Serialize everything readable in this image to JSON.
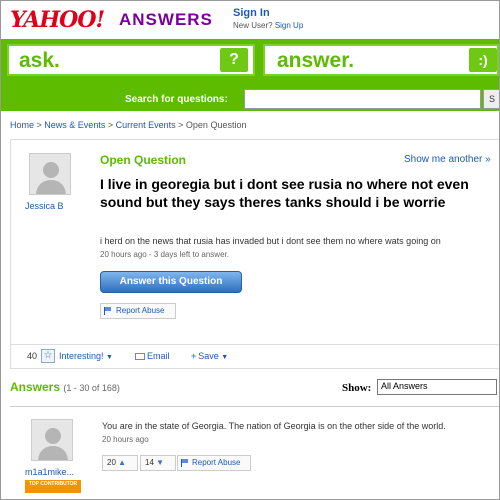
{
  "header": {
    "logo": "YAHOO!",
    "logo_suffix": "ANSWERS",
    "sign_in": "Sign In",
    "new_user_prefix": "New User?",
    "sign_up": "Sign Up"
  },
  "banner": {
    "ask_label": "ask.",
    "ask_icon": "?",
    "answer_label": "answer.",
    "answer_icon": ":)",
    "search_label": "Search for questions:",
    "search_value": "",
    "search_button": "S"
  },
  "breadcrumb": {
    "items": [
      "Home",
      "News & Events",
      "Current Events",
      "Open Question"
    ]
  },
  "question": {
    "user": "Jessica B",
    "status": "Open Question",
    "show_another": "Show me another »",
    "title": "I live in georegia but i dont see rusia no where not even sound but they says theres tanks should i be worrie",
    "detail": "i herd on the news that rusia has invaded but i dont see them no where wats going on",
    "time": "20 hours ago - 3 days left to answer.",
    "answer_button": "Answer this Question",
    "report_abuse": "Report Abuse",
    "interesting_count": "40",
    "interesting_label": "Interesting!",
    "email_label": "Email",
    "save_label": "Save"
  },
  "answers": {
    "heading": "Answers",
    "range": "(1 - 30 of 168)",
    "show_label": "Show:",
    "show_value": "All Answers",
    "items": [
      {
        "user": "m1a1mike...",
        "badge": "TOP CONTRIBUTOR",
        "text": "You are in the state of Georgia. The nation of Georgia is on the other side of the world.",
        "time": "20 hours ago",
        "thumbs_up": "20",
        "thumbs_down": "14",
        "report_abuse": "Report Abuse"
      }
    ]
  },
  "colors": {
    "brand_green": "#5dbb00",
    "link_blue": "#1d5ab4",
    "yahoo_red": "#e0001b",
    "answers_purple": "#7b0099",
    "badge_orange": "#f29400"
  }
}
